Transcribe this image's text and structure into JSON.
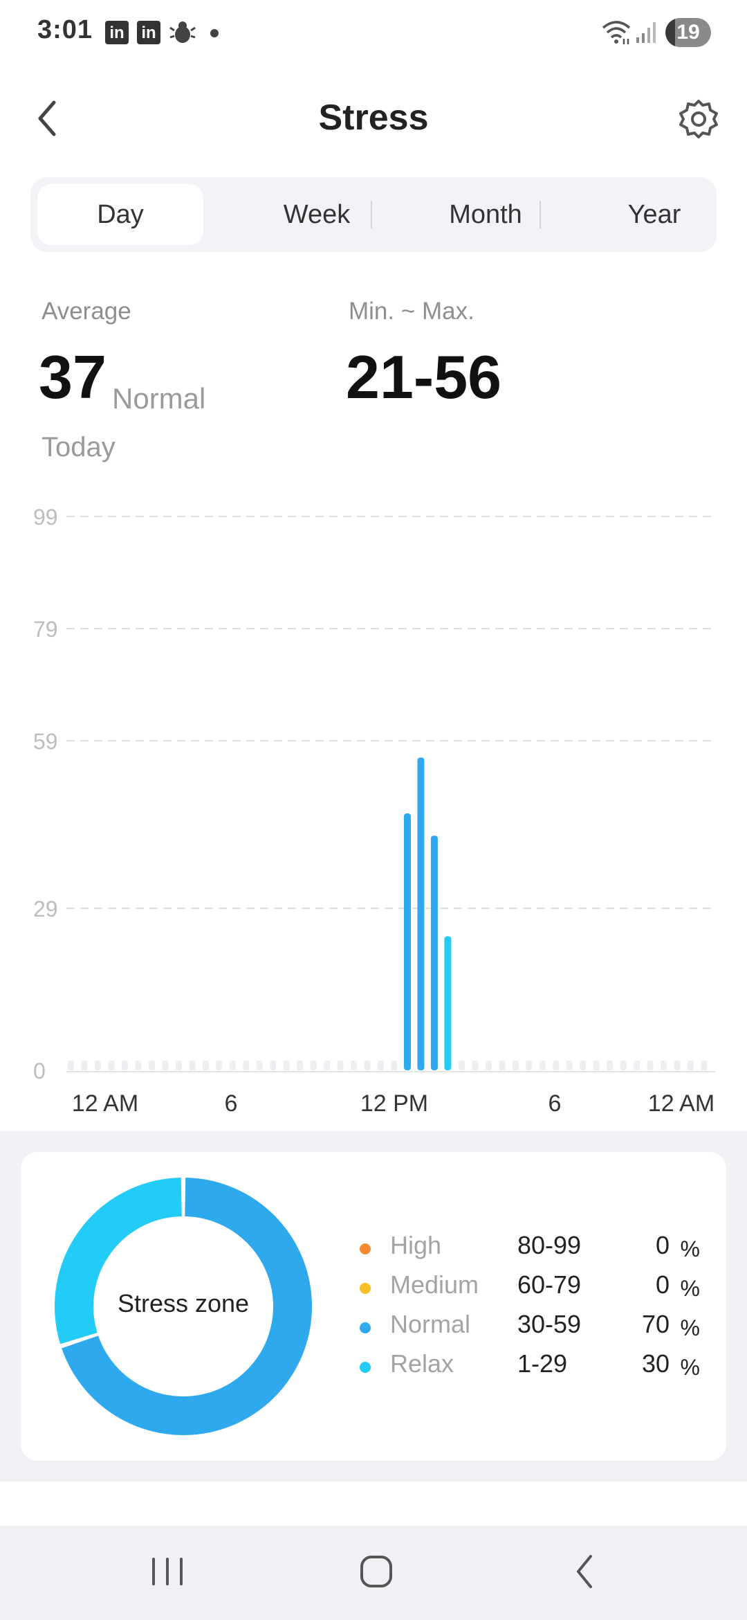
{
  "status_bar": {
    "time": "3:01",
    "icons": [
      "linkedin-icon",
      "linkedin-icon",
      "bug-icon",
      "dot-icon",
      "wifi-icon",
      "signal-icon",
      "battery-icon"
    ],
    "battery": "19"
  },
  "header": {
    "title": "Stress",
    "back_icon": "chevron-left-icon",
    "settings_icon": "gear-icon"
  },
  "tabs": [
    {
      "label": "Day",
      "active": true
    },
    {
      "label": "Week",
      "active": false
    },
    {
      "label": "Month",
      "active": false
    },
    {
      "label": "Year",
      "active": false
    }
  ],
  "summary": {
    "average_label": "Average",
    "average_value": "37",
    "average_status": "Normal",
    "range_label": "Min. ~ Max.",
    "range_value": "21-56",
    "period": "Today"
  },
  "chart_data": {
    "type": "bar",
    "y_ticks": [
      "99",
      "79",
      "59",
      "29",
      "0"
    ],
    "x_tick_labels": [
      "12 AM",
      "6",
      "12 PM",
      "6",
      "12 AM"
    ],
    "ylim": [
      0,
      99
    ],
    "grid": true,
    "bars": [
      {
        "time_hour": 12.5,
        "value": 46,
        "zone": "Normal"
      },
      {
        "time_hour": 13.0,
        "value": 56,
        "zone": "Normal"
      },
      {
        "time_hour": 13.5,
        "value": 42,
        "zone": "Normal"
      },
      {
        "time_hour": 14.0,
        "value": 24,
        "zone": "Relax"
      }
    ],
    "colors": {
      "Normal": "#2ea9ee",
      "Relax": "#22ccf7",
      "placeholder": "#eceef2",
      "grid": "#dddddd"
    }
  },
  "stress_zone": {
    "title": "Stress zone",
    "zones": [
      {
        "name": "High",
        "range": "80-99",
        "percent": "0",
        "unit": "%",
        "color": "#f58a34"
      },
      {
        "name": "Medium",
        "range": "60-79",
        "percent": "0",
        "unit": "%",
        "color": "#f7bf25"
      },
      {
        "name": "Normal",
        "range": "30-59",
        "percent": "70",
        "unit": "%",
        "color": "#2ea9ee"
      },
      {
        "name": "Relax",
        "range": "1-29",
        "percent": "30",
        "unit": "%",
        "color": "#22ccf7"
      }
    ]
  },
  "nav_bar": {
    "icons": [
      "recent-apps-icon",
      "home-icon",
      "back-icon"
    ]
  }
}
